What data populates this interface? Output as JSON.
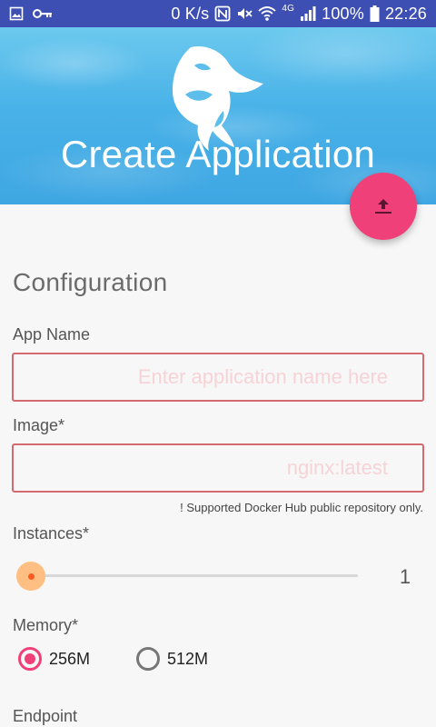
{
  "status_bar": {
    "speed": "0 K/s",
    "network_type": "4G",
    "battery": "100%",
    "time": "22:26",
    "icons": [
      "image-icon",
      "key-icon",
      "nfc-icon",
      "mute-icon",
      "wifi-icon",
      "signal-icon",
      "battery-icon"
    ]
  },
  "header": {
    "title": "Create Application",
    "logo_icon": "orca-logo-icon"
  },
  "fab": {
    "icon": "upload-icon",
    "color": "#f0407a"
  },
  "form": {
    "section_title": "Configuration",
    "app_name": {
      "label": "App Name",
      "placeholder": "Enter application name here",
      "value": ""
    },
    "image": {
      "label": "Image*",
      "placeholder": "nginx:latest",
      "value": "",
      "helper": "! Supported Docker Hub public repository only."
    },
    "instances": {
      "label": "Instances*",
      "value": "1",
      "slider_fraction": 0
    },
    "memory": {
      "label": "Memory*",
      "options": [
        {
          "label": "256M",
          "selected": true
        },
        {
          "label": "512M",
          "selected": false
        }
      ]
    },
    "endpoint": {
      "label": "Endpoint"
    }
  },
  "colors": {
    "status_bar": "#3e4fb4",
    "accent": "#f0407a",
    "error_outline": "#d26a6e",
    "slider_thumb": "#ffbf82"
  }
}
